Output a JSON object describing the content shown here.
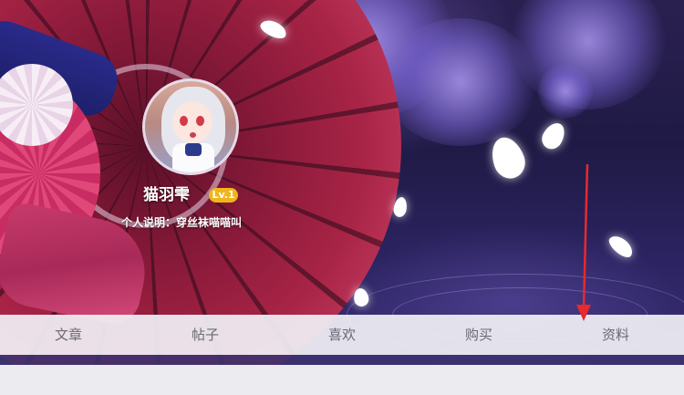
{
  "profile": {
    "username": "猫羽雫",
    "level": "Lv.1",
    "bio": "个人说明：穿丝袜喵喵叫"
  },
  "tabs": [
    {
      "label": "文章"
    },
    {
      "label": "帖子"
    },
    {
      "label": "喜欢"
    },
    {
      "label": "购买"
    },
    {
      "label": "资料"
    }
  ],
  "colors": {
    "level_badge": "#f1b51c",
    "annotation_arrow": "#e8292e",
    "tab_text": "#6a6a72"
  },
  "icons": [
    "avatar-image",
    "annotation-arrow"
  ]
}
